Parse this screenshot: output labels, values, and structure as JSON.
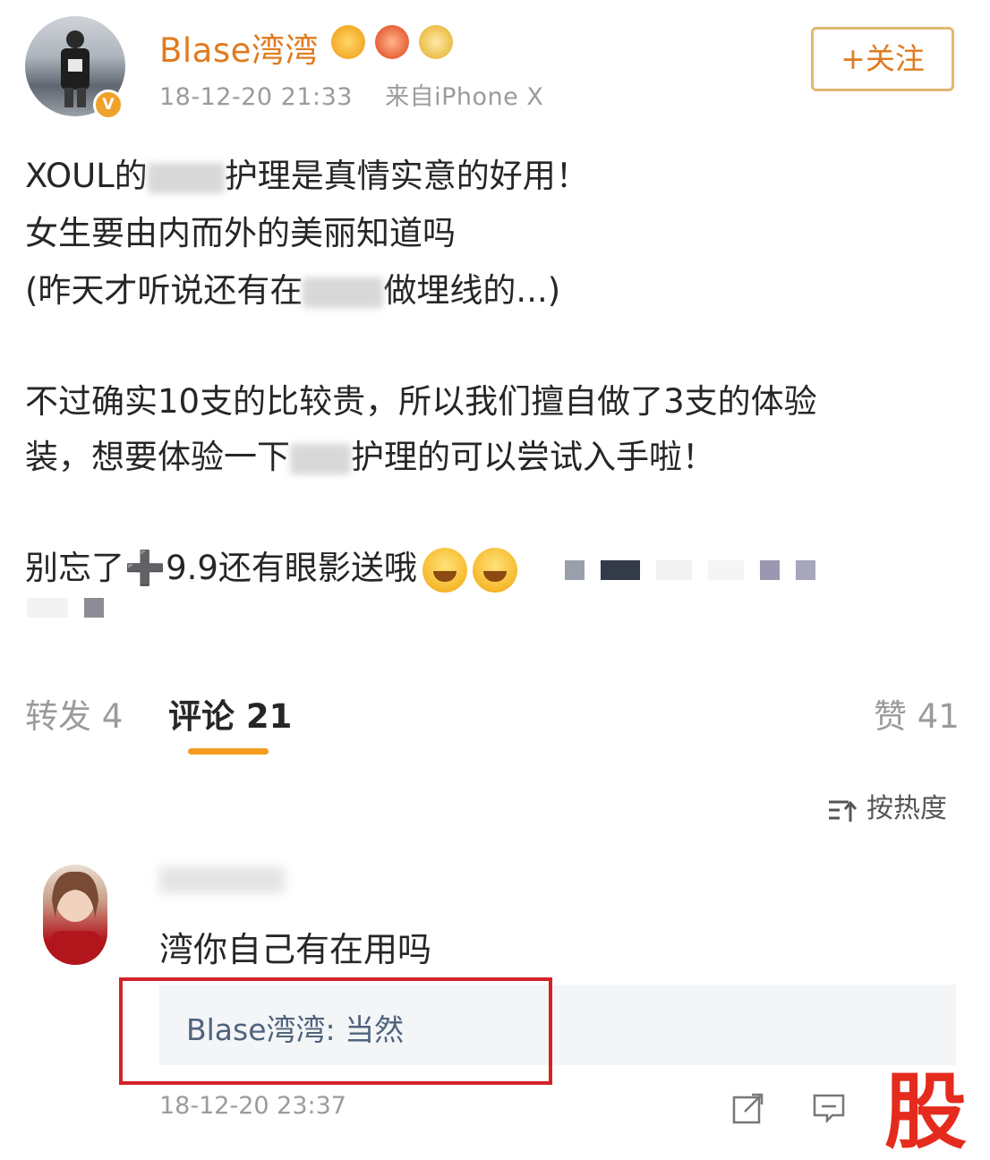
{
  "post": {
    "username": "Blase湾湾",
    "timestamp": "18-12-20 21:33",
    "source": "来自iPhone X",
    "follow_label": "+关注",
    "verified_badge": "V",
    "lines": {
      "l1_a": "XOUL的",
      "l1_b": "护理是真情实意的好用！",
      "l2": "女生要由内而外的美丽知道吗",
      "l3_a": "(昨天才听说还有在",
      "l3_b": "做埋线的...)",
      "l4": "不过确实10支的比较贵，所以我们擅自做了3支的体验",
      "l5_a": "装，想要体验一下",
      "l5_b": "护理的可以尝试入手啦！",
      "l6": "别忘了➕9.9还有眼影送哦"
    }
  },
  "actions": {
    "repost": "转发 4",
    "comments": "评论 21",
    "likes": "赞 41",
    "sort": "按热度"
  },
  "comment": {
    "text": "湾你自己有在用吗",
    "reply": "Blase湾湾: 当然",
    "timestamp": "18-12-20 23:37"
  },
  "watermark": "股",
  "colors": {
    "username": "#e07b1f",
    "accent_underline": "#f39c1f",
    "highlight_border": "#d42227",
    "reply_name": "#50637d"
  }
}
